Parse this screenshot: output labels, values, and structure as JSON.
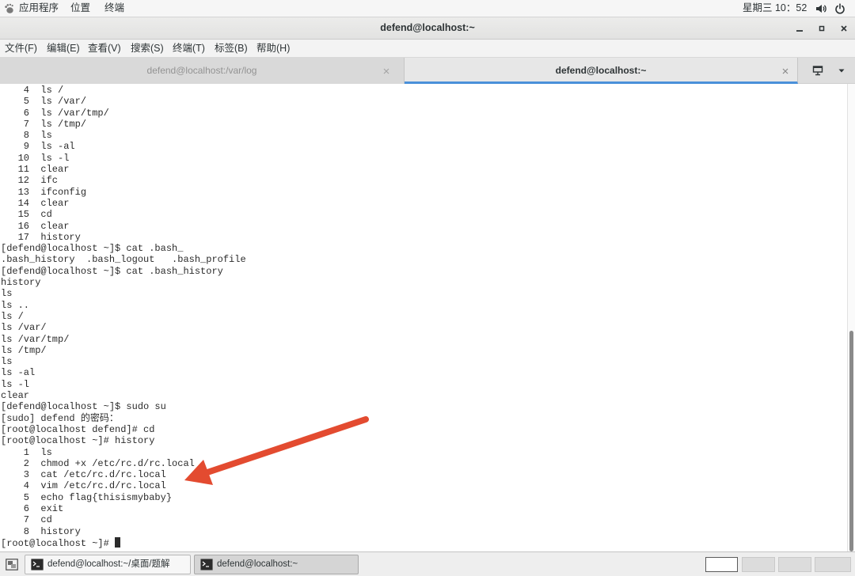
{
  "colors": {
    "accent": "#4a90d9",
    "annotation_arrow": "#e34b30",
    "terminal_text": "#2b2b2b",
    "terminal_background": "#ffffff"
  },
  "top_panel": {
    "applications": {
      "label": "应用程序",
      "icon": "gnome-foot-icon"
    },
    "places": {
      "label": "位置"
    },
    "active_app": {
      "label": "终端"
    },
    "clock": "星期三 10：52",
    "status_icons": [
      "volume-icon",
      "power-icon"
    ]
  },
  "window": {
    "title": "defend@localhost:~",
    "controls": [
      "minimize-icon",
      "maximize-icon",
      "close-icon"
    ]
  },
  "menu_bar": {
    "items": [
      "文件(F)",
      "编辑(E)",
      "查看(V)",
      "搜索(S)",
      "终端(T)",
      "标签(B)",
      "帮助(H)"
    ]
  },
  "tabs": [
    {
      "label": "defend@localhost:/var/log",
      "active": false
    },
    {
      "label": "defend@localhost:~",
      "active": true
    }
  ],
  "tab_bar_icons": [
    "new-tab-icon",
    "tab-list-dropdown-icon"
  ],
  "terminal": {
    "lines": [
      "    4  ls /",
      "    5  ls /var/",
      "    6  ls /var/tmp/",
      "    7  ls /tmp/",
      "    8  ls",
      "    9  ls -al",
      "   10  ls -l",
      "   11  clear",
      "   12  ifc",
      "   13  ifconfig",
      "   14  clear",
      "   15  cd",
      "   16  clear",
      "   17  history",
      "[defend@localhost ~]$ cat .bash_",
      ".bash_history  .bash_logout   .bash_profile",
      "[defend@localhost ~]$ cat .bash_history",
      "history",
      "ls",
      "ls ..",
      "ls /",
      "ls /var/",
      "ls /var/tmp/",
      "ls /tmp/",
      "ls",
      "ls -al",
      "ls -l",
      "clear",
      "[defend@localhost ~]$ sudo su",
      "[sudo] defend 的密码：",
      "[root@localhost defend]# cd",
      "[root@localhost ~]# history",
      "    1  ls",
      "    2  chmod +x /etc/rc.d/rc.local",
      "    3  cat /etc/rc.d/rc.local",
      "    4  vim /etc/rc.d/rc.local",
      "    5  echo flag{thisismybaby}",
      "    6  exit",
      "    7  cd",
      "    8  history"
    ],
    "prompt": "[root@localhost ~]# "
  },
  "taskbar": {
    "show_desktop_icon": "show-desktop-icon",
    "tasks": [
      {
        "label": "defend@localhost:~/桌面/题解",
        "icon": "terminal-icon",
        "active": false
      },
      {
        "label": "defend@localhost:~",
        "icon": "terminal-icon",
        "active": true
      }
    ]
  }
}
